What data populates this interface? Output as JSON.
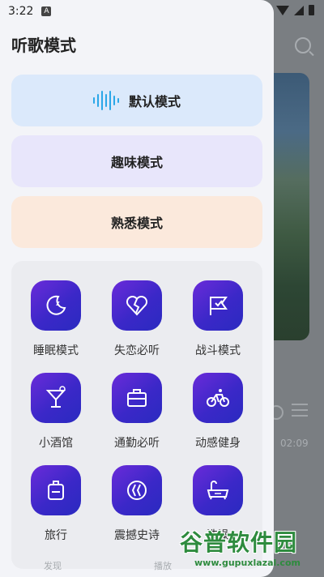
{
  "status": {
    "time": "3:22",
    "notif": "A"
  },
  "drawer": {
    "title": "听歌模式",
    "modes": [
      {
        "label": "默认模式",
        "selected": true
      },
      {
        "label": "趣味模式"
      },
      {
        "label": "熟悉模式"
      }
    ],
    "grid": [
      {
        "label": "睡眠模式",
        "icon": "moon-sleep-icon"
      },
      {
        "label": "失恋必听",
        "icon": "broken-heart-icon"
      },
      {
        "label": "战斗模式",
        "icon": "flag-icon"
      },
      {
        "label": "小酒馆",
        "icon": "cocktail-icon"
      },
      {
        "label": "通勤必听",
        "icon": "briefcase-icon"
      },
      {
        "label": "动感健身",
        "icon": "bicycle-icon"
      },
      {
        "label": "旅行",
        "icon": "luggage-icon"
      },
      {
        "label": "震撼史诗",
        "icon": "epic-icon"
      },
      {
        "label": "洗澡",
        "icon": "bathtub-icon"
      }
    ]
  },
  "background": {
    "duration": "02:09",
    "bottom_tabs": [
      "发现",
      "播放"
    ]
  },
  "watermark": {
    "text": "谷普软件园",
    "url": "www.gupuxlazal.com"
  },
  "colors": {
    "accent": "#2aa7e8",
    "tile_start": "#6a2bd9",
    "tile_end": "#2a2ac0"
  }
}
